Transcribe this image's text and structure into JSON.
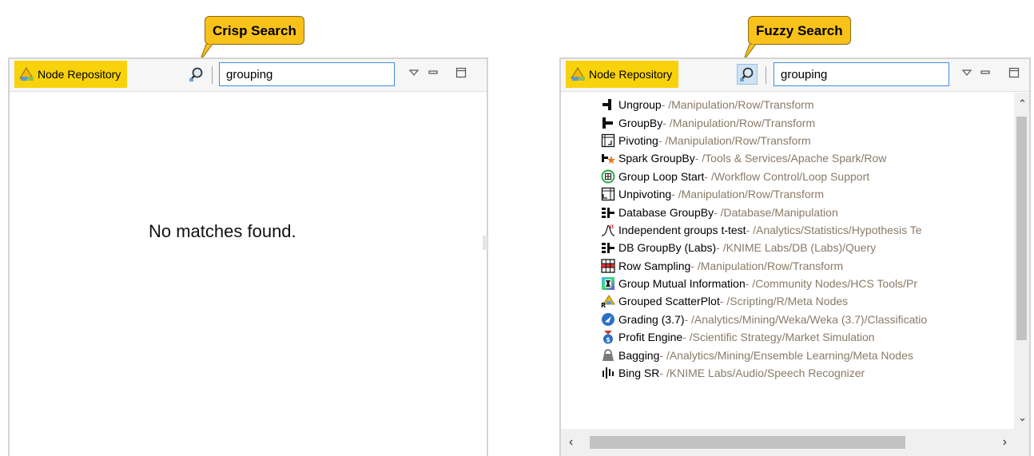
{
  "left": {
    "callout": "Crisp Search",
    "tab_label": "Node Repository",
    "search_value": "grouping",
    "empty_message": "No matches found."
  },
  "right": {
    "callout": "Fuzzy Search",
    "tab_label": "Node Repository",
    "search_value": "grouping",
    "results": [
      {
        "name": "Ungroup",
        "path": " - /Manipulation/Row/Transform",
        "icon": "ungroup-icon"
      },
      {
        "name": "GroupBy",
        "path": " - /Manipulation/Row/Transform",
        "icon": "groupby-icon"
      },
      {
        "name": "Pivoting",
        "path": " - /Manipulation/Row/Transform",
        "icon": "pivoting-icon"
      },
      {
        "name": "Spark GroupBy",
        "path": " - /Tools & Services/Apache Spark/Row",
        "icon": "spark-groupby-icon"
      },
      {
        "name": "Group Loop Start",
        "path": " - /Workflow Control/Loop Support",
        "icon": "group-loop-start-icon"
      },
      {
        "name": "Unpivoting",
        "path": " - /Manipulation/Row/Transform",
        "icon": "unpivoting-icon"
      },
      {
        "name": "Database GroupBy",
        "path": " - /Database/Manipulation",
        "icon": "database-groupby-icon"
      },
      {
        "name": "Independent groups t-test",
        "path": " - /Analytics/Statistics/Hypothesis Te",
        "icon": "t-test-icon"
      },
      {
        "name": "DB GroupBy (Labs)",
        "path": " - /KNIME Labs/DB (Labs)/Query",
        "icon": "db-groupby-icon"
      },
      {
        "name": "Row Sampling",
        "path": " - /Manipulation/Row/Transform",
        "icon": "row-sampling-icon"
      },
      {
        "name": "Group Mutual Information",
        "path": " - /Community Nodes/HCS Tools/Pr",
        "icon": "mutual-information-icon"
      },
      {
        "name": "Grouped ScatterPlot",
        "path": " - /Scripting/R/Meta Nodes",
        "icon": "r-scatterplot-icon"
      },
      {
        "name": "Grading (3.7)",
        "path": " - /Analytics/Mining/Weka/Weka (3.7)/Classificatio",
        "icon": "weka-icon"
      },
      {
        "name": "Profit Engine",
        "path": " - /Scientific Strategy/Market Simulation",
        "icon": "profit-engine-icon"
      },
      {
        "name": "Bagging",
        "path": " - /Analytics/Mining/Ensemble Learning/Meta Nodes",
        "icon": "bagging-icon"
      },
      {
        "name": "Bing SR",
        "path": " - /KNIME Labs/Audio/Speech Recognizer",
        "icon": "bing-sr-icon"
      }
    ]
  },
  "colors": {
    "callout_bg": "#f9c21b",
    "tab_bg": "#f8d20b",
    "path_text": "#8a7a66",
    "search_border": "#3c8de0"
  }
}
